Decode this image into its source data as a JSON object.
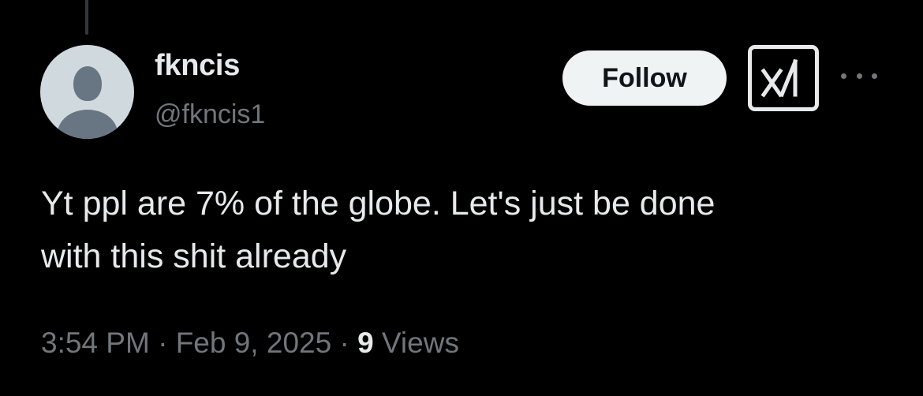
{
  "author": {
    "display_name": "fkncis",
    "handle": "@fkncis1",
    "avatar_icon": "default-avatar-icon"
  },
  "actions": {
    "follow_label": "Follow",
    "grok_icon": "grok-icon",
    "more_icon": "more-icon"
  },
  "tweet": {
    "line1": "Yt ppl are 7% of the globe. Let's just be done",
    "line2": "with this shit already"
  },
  "meta": {
    "time": "3:54 PM",
    "separator": "·",
    "date": "Feb 9, 2025",
    "views_count": "9",
    "views_label": "Views"
  },
  "colors": {
    "background": "#000000",
    "text_primary": "#e7e9ea",
    "text_secondary": "#71767b",
    "follow_bg": "#eff3f4",
    "avatar_bg": "#cfd9de",
    "avatar_fg": "#687684"
  }
}
